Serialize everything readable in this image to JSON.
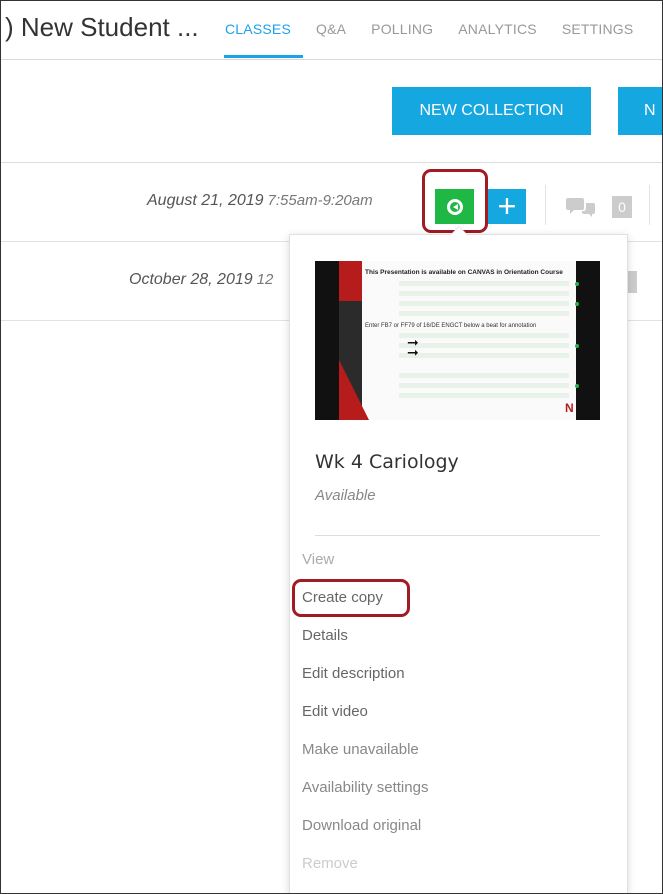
{
  "header": {
    "course_title": ") New Student ...",
    "tabs": [
      "CLASSES",
      "Q&A",
      "POLLING",
      "ANALYTICS",
      "SETTINGS"
    ]
  },
  "toolbar": {
    "new_collection_label": "NEW COLLECTION",
    "second_button_label": "N"
  },
  "rows": [
    {
      "date": "August 21, 2019",
      "time": "7:55am-9:20am",
      "comment_count": "0"
    },
    {
      "date": "October 28, 2019",
      "time": "12",
      "comment_count": ""
    }
  ],
  "dropdown": {
    "thumbnail": {
      "slide_title": "This Presentation is available on CANVAS in Orientation Course",
      "slide_text": "Enter FB7 or FF79 of 16/DE ENGCT below a beat for annotation"
    },
    "video_title": "Wk 4 Cariology",
    "video_status": "Available",
    "menu_items": [
      "View",
      "Create copy",
      "Details",
      "Edit description",
      "Edit video",
      "Make unavailable",
      "Availability settings",
      "Download original",
      "Remove"
    ]
  },
  "colors": {
    "accent_blue": "#15a7e0",
    "play_green": "#1fb845",
    "highlight_red": "#a01b22"
  },
  "icons": {
    "play": "play-circle-icon",
    "add": "plus-icon",
    "comments": "comments-icon"
  }
}
